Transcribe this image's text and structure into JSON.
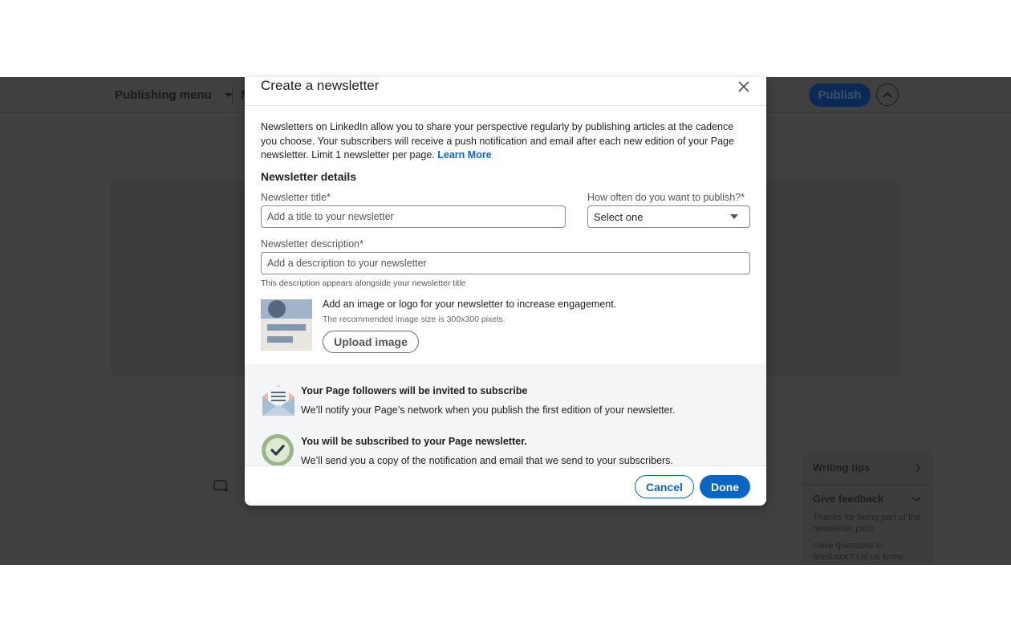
{
  "background": {
    "publishing_menu_label": "Publishing menu",
    "topbar_extra_label": "M",
    "publish_label": "Publish",
    "side_panel": {
      "writing_tips_label": "Writing tips",
      "give_feedback_label": "Give feedback",
      "feedback_text_1": "Thanks for being part of the newsletter pilot!",
      "feedback_text_2": "Have questions or feedback? Let us know."
    }
  },
  "modal": {
    "title": "Create a newsletter",
    "intro_text": "Newsletters on LinkedIn allow you to share your perspective regularly by publishing articles at the cadence you choose. Your subscribers will receive a push notification and email after each new edition of your Page newsletter. Limit 1 newsletter per page. ",
    "learn_more_label": "Learn More",
    "section_title": "Newsletter details",
    "title_field": {
      "label": "Newsletter title*",
      "placeholder": "Add a title to your newsletter",
      "value": ""
    },
    "frequency_field": {
      "label": "How often do you want to publish?*",
      "selected": "Select one"
    },
    "description_field": {
      "label": "Newsletter description*",
      "placeholder": "Add a description to your newsletter",
      "value": "",
      "hint": "This description appears alongside your newsletter title"
    },
    "image": {
      "text": "Add an image or logo for your newsletter to increase engagement.",
      "subtext": "The recommended image size is 300x300 pixels.",
      "upload_label": "Upload image"
    },
    "info_items": [
      {
        "icon": "envelope-icon",
        "title": "Your Page followers will be invited to subscribe",
        "desc": "We’ll notify your Page’s network when you publish the first edition of your newsletter."
      },
      {
        "icon": "checkmark-circle-icon",
        "title": "You will be subscribed to your Page newsletter.",
        "desc": "We’ll send you a copy of the notification and email that we send to your subscribers."
      }
    ],
    "cancel_label": "Cancel",
    "done_label": "Done"
  }
}
